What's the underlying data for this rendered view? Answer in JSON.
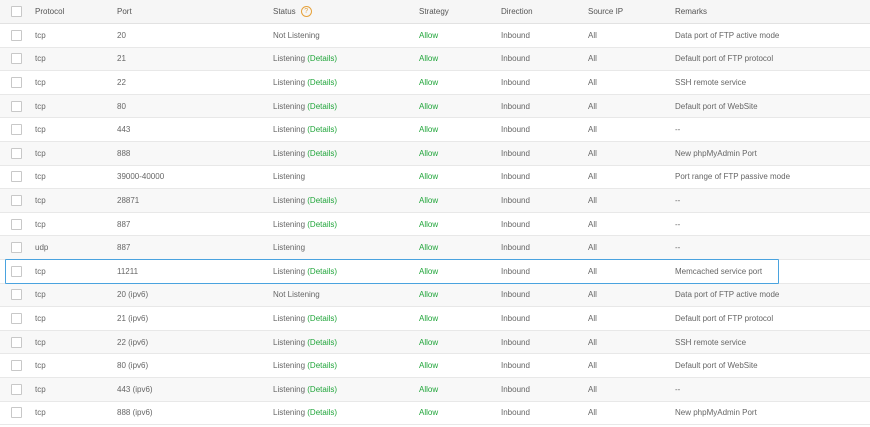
{
  "header": {
    "protocol": "Protocol",
    "port": "Port",
    "status": "Status",
    "strategy": "Strategy",
    "direction": "Direction",
    "source_ip": "Source IP",
    "remarks": "Remarks"
  },
  "colors": {
    "green": "#20a53a",
    "highlight": "#4aa3df",
    "help": "#e6a23c"
  },
  "rows": [
    {
      "protocol": "tcp",
      "port": "20",
      "status": "Not Listening",
      "details": "",
      "strategy": "Allow",
      "direction": "Inbound",
      "source_ip": "All",
      "remarks": "Data port of FTP active mode"
    },
    {
      "protocol": "tcp",
      "port": "21",
      "status": "Listening",
      "details": "(Details)",
      "strategy": "Allow",
      "direction": "Inbound",
      "source_ip": "All",
      "remarks": "Default port of FTP protocol"
    },
    {
      "protocol": "tcp",
      "port": "22",
      "status": "Listening",
      "details": "(Details)",
      "strategy": "Allow",
      "direction": "Inbound",
      "source_ip": "All",
      "remarks": "SSH remote service"
    },
    {
      "protocol": "tcp",
      "port": "80",
      "status": "Listening",
      "details": "(Details)",
      "strategy": "Allow",
      "direction": "Inbound",
      "source_ip": "All",
      "remarks": "Default port of WebSite"
    },
    {
      "protocol": "tcp",
      "port": "443",
      "status": "Listening",
      "details": "(Details)",
      "strategy": "Allow",
      "direction": "Inbound",
      "source_ip": "All",
      "remarks": "--"
    },
    {
      "protocol": "tcp",
      "port": "888",
      "status": "Listening",
      "details": "(Details)",
      "strategy": "Allow",
      "direction": "Inbound",
      "source_ip": "All",
      "remarks": "New phpMyAdmin Port"
    },
    {
      "protocol": "tcp",
      "port": "39000-40000",
      "status": "Listening",
      "details": "",
      "strategy": "Allow",
      "direction": "Inbound",
      "source_ip": "All",
      "remarks": "Port range of FTP passive mode"
    },
    {
      "protocol": "tcp",
      "port": "28871",
      "status": "Listening",
      "details": "(Details)",
      "strategy": "Allow",
      "direction": "Inbound",
      "source_ip": "All",
      "remarks": "--"
    },
    {
      "protocol": "tcp",
      "port": "887",
      "status": "Listening",
      "details": "(Details)",
      "strategy": "Allow",
      "direction": "Inbound",
      "source_ip": "All",
      "remarks": "--"
    },
    {
      "protocol": "udp",
      "port": "887",
      "status": "Listening",
      "details": "",
      "strategy": "Allow",
      "direction": "Inbound",
      "source_ip": "All",
      "remarks": "--"
    },
    {
      "protocol": "tcp",
      "port": "11211",
      "status": "Listening",
      "details": "(Details)",
      "strategy": "Allow",
      "direction": "Inbound",
      "source_ip": "All",
      "remarks": "Memcached service port"
    },
    {
      "protocol": "tcp",
      "port": "20 (ipv6)",
      "status": "Not Listening",
      "details": "",
      "strategy": "Allow",
      "direction": "Inbound",
      "source_ip": "All",
      "remarks": "Data port of FTP active mode"
    },
    {
      "protocol": "tcp",
      "port": "21 (ipv6)",
      "status": "Listening",
      "details": "(Details)",
      "strategy": "Allow",
      "direction": "Inbound",
      "source_ip": "All",
      "remarks": "Default port of FTP protocol"
    },
    {
      "protocol": "tcp",
      "port": "22 (ipv6)",
      "status": "Listening",
      "details": "(Details)",
      "strategy": "Allow",
      "direction": "Inbound",
      "source_ip": "All",
      "remarks": "SSH remote service"
    },
    {
      "protocol": "tcp",
      "port": "80 (ipv6)",
      "status": "Listening",
      "details": "(Details)",
      "strategy": "Allow",
      "direction": "Inbound",
      "source_ip": "All",
      "remarks": "Default port of WebSite"
    },
    {
      "protocol": "tcp",
      "port": "443 (ipv6)",
      "status": "Listening",
      "details": "(Details)",
      "strategy": "Allow",
      "direction": "Inbound",
      "source_ip": "All",
      "remarks": "--"
    },
    {
      "protocol": "tcp",
      "port": "888 (ipv6)",
      "status": "Listening",
      "details": "(Details)",
      "strategy": "Allow",
      "direction": "Inbound",
      "source_ip": "All",
      "remarks": "New phpMyAdmin Port"
    }
  ]
}
